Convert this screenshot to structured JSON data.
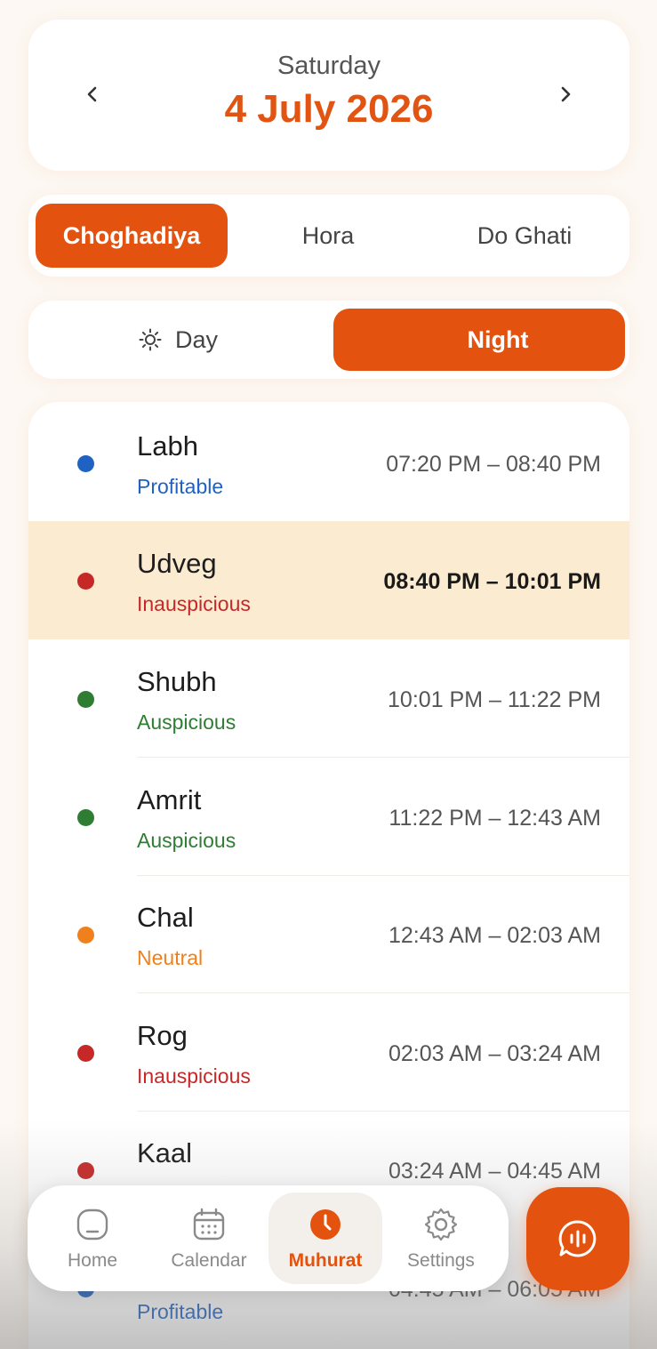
{
  "date": {
    "weekday": "Saturday",
    "full_date": "4 July 2026"
  },
  "tabs": [
    {
      "label": "Choghadiya",
      "active": true
    },
    {
      "label": "Hora",
      "active": false
    },
    {
      "label": "Do Ghati",
      "active": false
    }
  ],
  "period_toggle": {
    "day_label": "Day",
    "night_label": "Night",
    "active": "Night"
  },
  "rows": [
    {
      "name": "Labh",
      "quality": "Profitable",
      "time": "07:20 PM – 08:40 PM",
      "color": "#1f62c4",
      "current": false
    },
    {
      "name": "Udveg",
      "quality": "Inauspicious",
      "time": "08:40 PM – 10:01 PM",
      "color": "#c62828",
      "current": true
    },
    {
      "name": "Shubh",
      "quality": "Auspicious",
      "time": "10:01 PM – 11:22 PM",
      "color": "#2e7d32",
      "current": false
    },
    {
      "name": "Amrit",
      "quality": "Auspicious",
      "time": "11:22 PM – 12:43 AM",
      "color": "#2e7d32",
      "current": false
    },
    {
      "name": "Chal",
      "quality": "Neutral",
      "time": "12:43 AM – 02:03 AM",
      "color": "#f0801c",
      "current": false
    },
    {
      "name": "Rog",
      "quality": "Inauspicious",
      "time": "02:03 AM – 03:24 AM",
      "color": "#c62828",
      "current": false
    },
    {
      "name": "Kaal",
      "quality": "",
      "time": "03:24 AM – 04:45 AM",
      "color": "#c62828",
      "current": false
    },
    {
      "name": "",
      "quality": "Profitable",
      "time": "04:45 AM – 06:05 AM",
      "color": "#1f62c4",
      "current": false
    }
  ],
  "bottom_nav": [
    {
      "label": "Home",
      "icon": "home-icon",
      "active": false
    },
    {
      "label": "Calendar",
      "icon": "calendar-icon",
      "active": false
    },
    {
      "label": "Muhurat",
      "icon": "clock-icon",
      "active": true
    },
    {
      "label": "Settings",
      "icon": "gear-icon",
      "active": false
    }
  ],
  "fab": {
    "icon": "voice-chat-icon"
  },
  "colors": {
    "accent": "#e3530f",
    "highlight_row": "#fbebd0",
    "profitable": "#1f62c4",
    "inauspicious": "#c62828",
    "auspicious": "#2e7d32",
    "neutral": "#f0801c"
  }
}
